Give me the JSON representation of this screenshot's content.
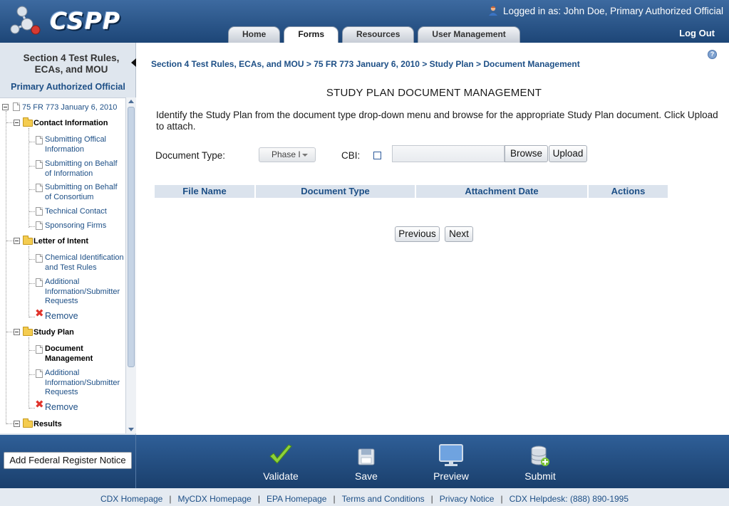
{
  "app": {
    "name": "CSPP"
  },
  "header": {
    "logged_in_prefix": "Logged in as:",
    "user": "John Doe, Primary Authorized Official",
    "logout": "Log Out",
    "tabs": [
      {
        "label": "Home"
      },
      {
        "label": "Forms"
      },
      {
        "label": "Resources"
      },
      {
        "label": "User Management"
      }
    ]
  },
  "sidebar": {
    "title_line1": "Section 4 Test Rules,",
    "title_line2": "ECAs, and MOU",
    "role": "Primary Authorized Official",
    "tree": {
      "root": "75 FR 773 January 6, 2010",
      "contact": "Contact Information",
      "submitting_official_1": "Submitting Offical",
      "submitting_official_2": "Information",
      "behalf_info_1": "Submitting on Behalf",
      "behalf_info_2": "of Information",
      "behalf_consortium_1": "Submitting on Behalf",
      "behalf_consortium_2": "of Consortium",
      "technical_contact": "Technical Contact",
      "sponsoring_firms": "Sponsoring Firms",
      "letter_of_intent": "Letter of Intent",
      "chem_id_1": "Chemical Identification",
      "chem_id_2": "and Test Rules",
      "loi_additional_1": "Additional",
      "loi_additional_2": "Information/Submitter",
      "loi_additional_3": "Requests",
      "remove": "Remove",
      "study_plan": "Study Plan",
      "doc_mgmt_1": "Document",
      "doc_mgmt_2": "Management",
      "sp_additional_1": "Additional",
      "sp_additional_2": "Information/Submitter",
      "sp_additional_3": "Requests",
      "results": "Results"
    }
  },
  "main": {
    "breadcrumb": [
      "Section 4 Test Rules, ECAs, and MOU",
      "75 FR 773 January 6, 2010",
      "Study Plan",
      "Document Management"
    ],
    "breadcrumb_sep": ">",
    "title": "STUDY PLAN DOCUMENT MANAGEMENT",
    "instructions": "Identify the Study Plan from the document type drop-down menu and browse for the appropriate Study Plan document. Click Upload to attach.",
    "document_type_label": "Document Type:",
    "document_type_value": "Phase I",
    "cbi_label": "CBI:",
    "browse": "Browse",
    "upload": "Upload",
    "table_headers": [
      "File Name",
      "Document Type",
      "Attachment Date",
      "Actions"
    ],
    "previous": "Previous",
    "next": "Next"
  },
  "actions": {
    "add_frn": "Add Federal Register Notice",
    "validate": "Validate",
    "save": "Save",
    "preview": "Preview",
    "submit": "Submit"
  },
  "footer": {
    "links": [
      "CDX Homepage",
      "MyCDX Homepage",
      "EPA Homepage",
      "Terms and Conditions",
      "Privacy Notice",
      "CDX Helpdesk: (888) 890-1995"
    ],
    "separator": "|"
  }
}
